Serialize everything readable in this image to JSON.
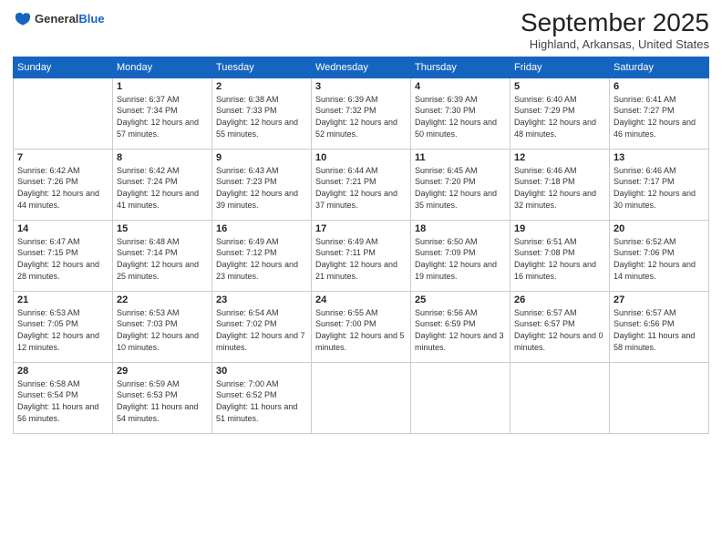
{
  "logo": {
    "general": "General",
    "blue": "Blue"
  },
  "title": "September 2025",
  "location": "Highland, Arkansas, United States",
  "days_of_week": [
    "Sunday",
    "Monday",
    "Tuesday",
    "Wednesday",
    "Thursday",
    "Friday",
    "Saturday"
  ],
  "weeks": [
    [
      {
        "day": null,
        "sunrise": null,
        "sunset": null,
        "daylight": null
      },
      {
        "day": "1",
        "sunrise": "Sunrise: 6:37 AM",
        "sunset": "Sunset: 7:34 PM",
        "daylight": "Daylight: 12 hours and 57 minutes."
      },
      {
        "day": "2",
        "sunrise": "Sunrise: 6:38 AM",
        "sunset": "Sunset: 7:33 PM",
        "daylight": "Daylight: 12 hours and 55 minutes."
      },
      {
        "day": "3",
        "sunrise": "Sunrise: 6:39 AM",
        "sunset": "Sunset: 7:32 PM",
        "daylight": "Daylight: 12 hours and 52 minutes."
      },
      {
        "day": "4",
        "sunrise": "Sunrise: 6:39 AM",
        "sunset": "Sunset: 7:30 PM",
        "daylight": "Daylight: 12 hours and 50 minutes."
      },
      {
        "day": "5",
        "sunrise": "Sunrise: 6:40 AM",
        "sunset": "Sunset: 7:29 PM",
        "daylight": "Daylight: 12 hours and 48 minutes."
      },
      {
        "day": "6",
        "sunrise": "Sunrise: 6:41 AM",
        "sunset": "Sunset: 7:27 PM",
        "daylight": "Daylight: 12 hours and 46 minutes."
      }
    ],
    [
      {
        "day": "7",
        "sunrise": "Sunrise: 6:42 AM",
        "sunset": "Sunset: 7:26 PM",
        "daylight": "Daylight: 12 hours and 44 minutes."
      },
      {
        "day": "8",
        "sunrise": "Sunrise: 6:42 AM",
        "sunset": "Sunset: 7:24 PM",
        "daylight": "Daylight: 12 hours and 41 minutes."
      },
      {
        "day": "9",
        "sunrise": "Sunrise: 6:43 AM",
        "sunset": "Sunset: 7:23 PM",
        "daylight": "Daylight: 12 hours and 39 minutes."
      },
      {
        "day": "10",
        "sunrise": "Sunrise: 6:44 AM",
        "sunset": "Sunset: 7:21 PM",
        "daylight": "Daylight: 12 hours and 37 minutes."
      },
      {
        "day": "11",
        "sunrise": "Sunrise: 6:45 AM",
        "sunset": "Sunset: 7:20 PM",
        "daylight": "Daylight: 12 hours and 35 minutes."
      },
      {
        "day": "12",
        "sunrise": "Sunrise: 6:46 AM",
        "sunset": "Sunset: 7:18 PM",
        "daylight": "Daylight: 12 hours and 32 minutes."
      },
      {
        "day": "13",
        "sunrise": "Sunrise: 6:46 AM",
        "sunset": "Sunset: 7:17 PM",
        "daylight": "Daylight: 12 hours and 30 minutes."
      }
    ],
    [
      {
        "day": "14",
        "sunrise": "Sunrise: 6:47 AM",
        "sunset": "Sunset: 7:15 PM",
        "daylight": "Daylight: 12 hours and 28 minutes."
      },
      {
        "day": "15",
        "sunrise": "Sunrise: 6:48 AM",
        "sunset": "Sunset: 7:14 PM",
        "daylight": "Daylight: 12 hours and 25 minutes."
      },
      {
        "day": "16",
        "sunrise": "Sunrise: 6:49 AM",
        "sunset": "Sunset: 7:12 PM",
        "daylight": "Daylight: 12 hours and 23 minutes."
      },
      {
        "day": "17",
        "sunrise": "Sunrise: 6:49 AM",
        "sunset": "Sunset: 7:11 PM",
        "daylight": "Daylight: 12 hours and 21 minutes."
      },
      {
        "day": "18",
        "sunrise": "Sunrise: 6:50 AM",
        "sunset": "Sunset: 7:09 PM",
        "daylight": "Daylight: 12 hours and 19 minutes."
      },
      {
        "day": "19",
        "sunrise": "Sunrise: 6:51 AM",
        "sunset": "Sunset: 7:08 PM",
        "daylight": "Daylight: 12 hours and 16 minutes."
      },
      {
        "day": "20",
        "sunrise": "Sunrise: 6:52 AM",
        "sunset": "Sunset: 7:06 PM",
        "daylight": "Daylight: 12 hours and 14 minutes."
      }
    ],
    [
      {
        "day": "21",
        "sunrise": "Sunrise: 6:53 AM",
        "sunset": "Sunset: 7:05 PM",
        "daylight": "Daylight: 12 hours and 12 minutes."
      },
      {
        "day": "22",
        "sunrise": "Sunrise: 6:53 AM",
        "sunset": "Sunset: 7:03 PM",
        "daylight": "Daylight: 12 hours and 10 minutes."
      },
      {
        "day": "23",
        "sunrise": "Sunrise: 6:54 AM",
        "sunset": "Sunset: 7:02 PM",
        "daylight": "Daylight: 12 hours and 7 minutes."
      },
      {
        "day": "24",
        "sunrise": "Sunrise: 6:55 AM",
        "sunset": "Sunset: 7:00 PM",
        "daylight": "Daylight: 12 hours and 5 minutes."
      },
      {
        "day": "25",
        "sunrise": "Sunrise: 6:56 AM",
        "sunset": "Sunset: 6:59 PM",
        "daylight": "Daylight: 12 hours and 3 minutes."
      },
      {
        "day": "26",
        "sunrise": "Sunrise: 6:57 AM",
        "sunset": "Sunset: 6:57 PM",
        "daylight": "Daylight: 12 hours and 0 minutes."
      },
      {
        "day": "27",
        "sunrise": "Sunrise: 6:57 AM",
        "sunset": "Sunset: 6:56 PM",
        "daylight": "Daylight: 11 hours and 58 minutes."
      }
    ],
    [
      {
        "day": "28",
        "sunrise": "Sunrise: 6:58 AM",
        "sunset": "Sunset: 6:54 PM",
        "daylight": "Daylight: 11 hours and 56 minutes."
      },
      {
        "day": "29",
        "sunrise": "Sunrise: 6:59 AM",
        "sunset": "Sunset: 6:53 PM",
        "daylight": "Daylight: 11 hours and 54 minutes."
      },
      {
        "day": "30",
        "sunrise": "Sunrise: 7:00 AM",
        "sunset": "Sunset: 6:52 PM",
        "daylight": "Daylight: 11 hours and 51 minutes."
      },
      {
        "day": null,
        "sunrise": null,
        "sunset": null,
        "daylight": null
      },
      {
        "day": null,
        "sunrise": null,
        "sunset": null,
        "daylight": null
      },
      {
        "day": null,
        "sunrise": null,
        "sunset": null,
        "daylight": null
      },
      {
        "day": null,
        "sunrise": null,
        "sunset": null,
        "daylight": null
      }
    ]
  ]
}
